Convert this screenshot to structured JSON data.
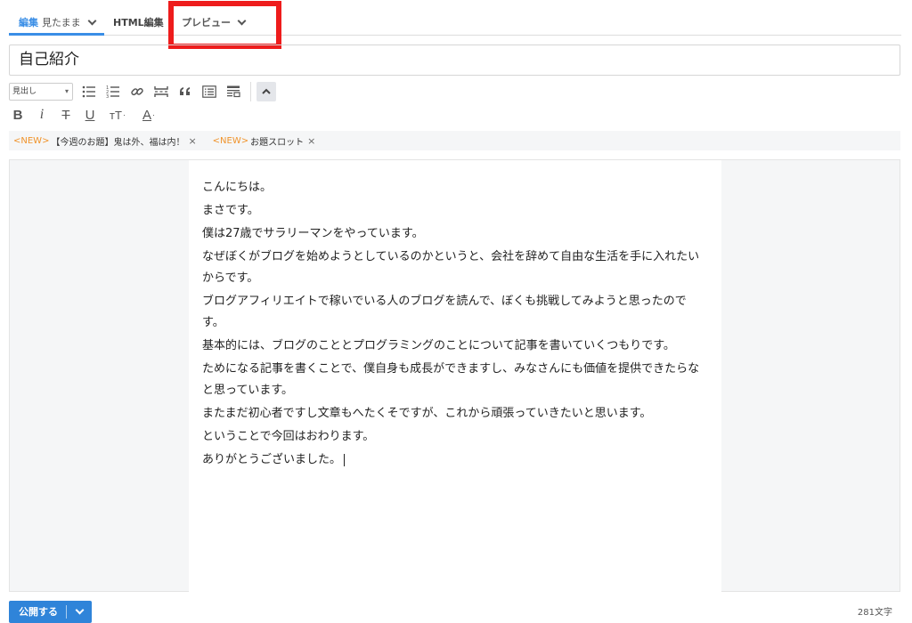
{
  "tabs": [
    {
      "label": "編集",
      "sub": "見たまま"
    },
    {
      "label": "HTML編集"
    },
    {
      "label": "プレビュー"
    }
  ],
  "title": "自己紹介",
  "toolbar": {
    "heading_select": "見出し",
    "buttons": [
      "bulleted-list-icon",
      "numbered-list-icon",
      "link-icon",
      "read-more-icon",
      "quote-icon",
      "table-of-contents-icon",
      "embed-icon",
      "collapse-icon"
    ],
    "format": {
      "bold": "B",
      "italic": "i",
      "strike": "T",
      "underline": "U",
      "size": "тT",
      "color": "A"
    }
  },
  "topics": [
    {
      "badge": "<NEW>",
      "label": "【今週のお題】鬼は外、福は内！",
      "close": "×"
    },
    {
      "badge": "<NEW>",
      "label": "お題スロット",
      "close": "×"
    }
  ],
  "body": [
    "こんにちは。",
    "まさです。",
    "僕は27歳でサラリーマンをやっています。",
    "なぜぼくがブログを始めようとしているのかというと、会社を辞めて自由な生活を手に入れたいからです。",
    "ブログアフィリエイトで稼いでいる人のブログを読んで、ぼくも挑戦してみようと思ったのです。",
    "基本的には、ブログのこととプログラミングのことについて記事を書いていくつもりです。",
    "ためになる記事を書くことで、僕自身も成長ができますし、みなさんにも価値を提供できたらなと思っています。",
    "またまだ初心者ですし文章もへたくそですが、これから頑張っていきたいと思います。",
    "ということで今回はおわります。",
    "ありがとうございました。"
  ],
  "footer": {
    "publish_label": "公開する",
    "char_count": "281文字"
  },
  "colors": {
    "accent": "#3a8ee6",
    "highlight": "#ee1c1c",
    "new_badge": "#f0932b",
    "publish": "#2f84d9"
  }
}
